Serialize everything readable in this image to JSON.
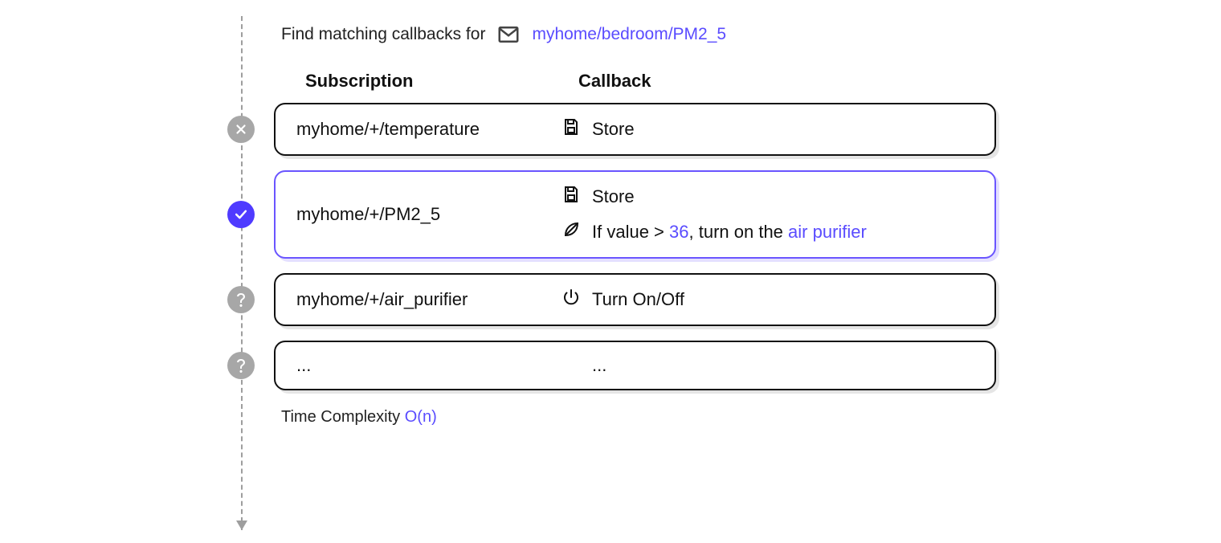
{
  "header": {
    "prefix": "Find matching callbacks for",
    "topic": "myhome/bedroom/PM2_5"
  },
  "columns": {
    "subscription": "Subscription",
    "callback": "Callback"
  },
  "rows": [
    {
      "status": "no",
      "subscription": "myhome/+/temperature",
      "callbacks": [
        {
          "icon": "save-icon",
          "text": "Store"
        }
      ]
    },
    {
      "status": "yes",
      "subscription": "myhome/+/PM2_5",
      "callbacks": [
        {
          "icon": "save-icon",
          "text": "Store"
        },
        {
          "icon": "leaf-icon",
          "prefix": "If value > ",
          "value": "36",
          "mid": ", turn on the ",
          "link": "air purifier"
        }
      ]
    },
    {
      "status": "pending",
      "subscription": "myhome/+/air_purifier",
      "callbacks": [
        {
          "icon": "power-icon",
          "text": "Turn On/Off"
        }
      ]
    },
    {
      "status": "pending",
      "subscription": "...",
      "callbacks": [
        {
          "icon": "none",
          "text": "..."
        }
      ]
    }
  ],
  "footer": {
    "label": "Time Complexity ",
    "big_o": "O(n)"
  }
}
